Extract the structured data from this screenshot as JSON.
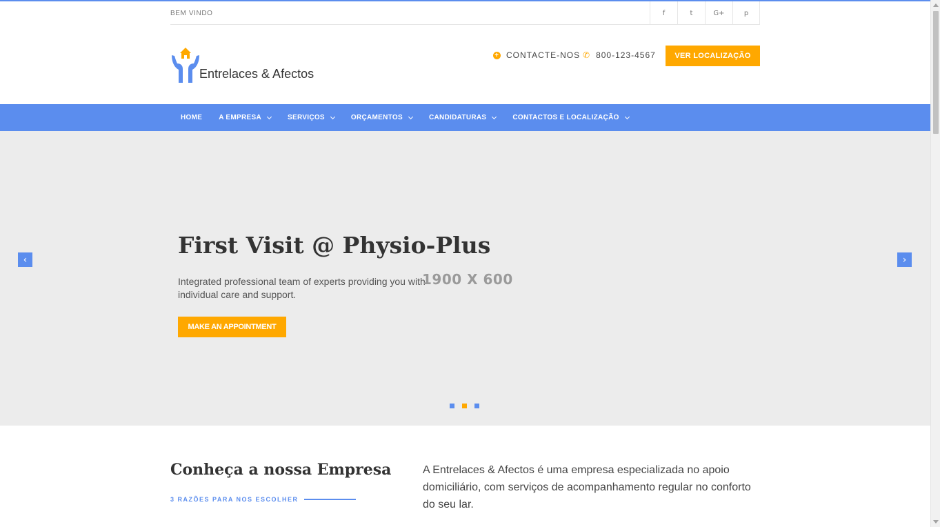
{
  "topbar": {
    "welcome": "BEM VINDO",
    "socials": [
      {
        "icon": "facebook-icon",
        "glyph": "f"
      },
      {
        "icon": "twitter-icon",
        "glyph": "t"
      },
      {
        "icon": "google-plus-icon",
        "glyph": "G+"
      },
      {
        "icon": "pinterest-icon",
        "glyph": "p"
      }
    ]
  },
  "brand": {
    "name": "Entrelaces & Afectos",
    "logo_icon": "hands-house-logo",
    "colors": {
      "primary": "#5b8dee",
      "accent": "#ffa800"
    }
  },
  "header": {
    "contact_label": "CONTACTE-NOS",
    "phone": "800-123-4567",
    "location_button": "VER LOCALIZAÇÃO"
  },
  "nav": {
    "items": [
      {
        "label": "HOME",
        "has_dropdown": false
      },
      {
        "label": "A EMPRESA",
        "has_dropdown": true
      },
      {
        "label": "SERVIÇOS",
        "has_dropdown": true
      },
      {
        "label": "ORÇAMENTOS",
        "has_dropdown": true
      },
      {
        "label": "CANDIDATURAS",
        "has_dropdown": true
      },
      {
        "label": "CONTACTOS E LOCALIZAÇÃO",
        "has_dropdown": true
      }
    ]
  },
  "hero": {
    "title": "First Visit @ Physio-Plus",
    "description": "Integrated professional team of experts providing you with individual care and support.",
    "placeholder_size": "1900 X 600",
    "button": "MAKE AN APPOINTMENT",
    "prev_glyph": "‹",
    "next_glyph": "›",
    "slide_count": 3,
    "active_slide": 2
  },
  "about": {
    "title": "Conheça a nossa Empresa",
    "subtitle": "3 RAZÕES PARA NOS ESCOLHER",
    "text": "A Entrelaces & Afectos é uma empresa especializada no apoio domiciliário, com serviços de acompanhamento regular no conforto do seu lar."
  }
}
